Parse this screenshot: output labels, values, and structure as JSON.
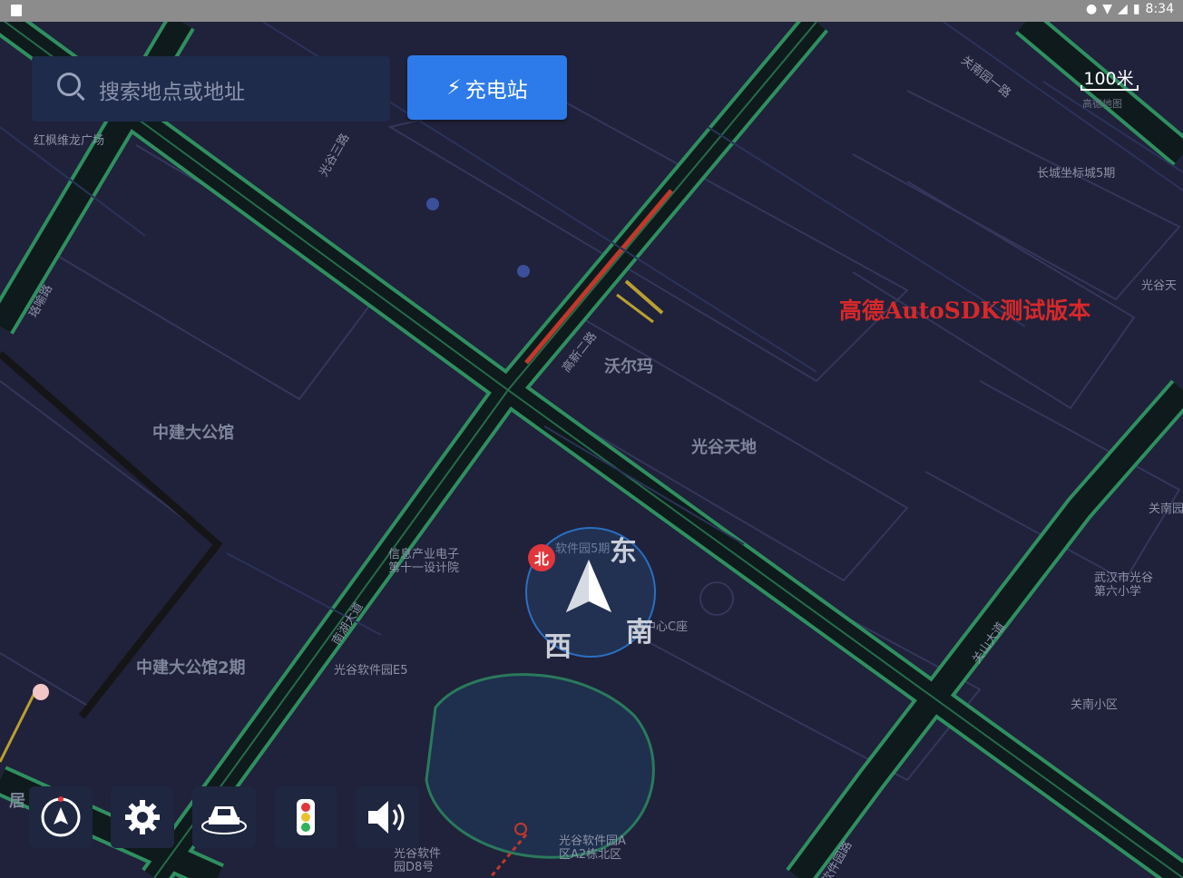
{
  "status_bar": {
    "time": "8:34"
  },
  "search": {
    "placeholder": "搜索地点或地址"
  },
  "charge_button": {
    "label": "充电站"
  },
  "scale": {
    "value": "100米",
    "source": "高德地图"
  },
  "watermark": "高德AutoSDK测试版本",
  "compass": {
    "north": "北",
    "east": "东",
    "west": "西",
    "south": "南"
  },
  "pois": {
    "hongfeng": "红枫维龙广场",
    "changcheng": "长城坐标城5期",
    "guanggutian": "光谷天",
    "woerma": "沃尔玛",
    "guanggutiandi": "光谷天地",
    "zhongjian": "中建大公馆",
    "zhongjian2": "中建大公馆2期",
    "xinxi": "信息产业电子\n第十一设计院",
    "ruanjian5": "软件园5期",
    "ruanjian_e5": "光谷软件园E5",
    "center_c": "D中心C座",
    "guannan_road": "关南园",
    "wuhanshi": "武汉市光谷\n第六小学",
    "guannan_xq": "关南小区",
    "ruanjian_a": "光谷软件园A\n区A2栋北区",
    "ruanjian_d8": "光谷软件\n园D8号",
    "ju": "居"
  },
  "roads": {
    "gaoxin2": "高新二路",
    "nanhu": "南湖大道",
    "guannan": "关南园一路",
    "ruanjian_road": "软件园路",
    "guanshan": "关山大道",
    "luyu": "珞喻路",
    "guangu_sandalu": "光谷三路"
  },
  "toolbar": {
    "items": [
      "compass-icon",
      "gear-icon",
      "car-view-icon",
      "traffic-light-icon",
      "volume-icon"
    ]
  },
  "colors": {
    "map_bg": "#20213a",
    "road_green": "#2f8f60",
    "road_dark": "#0f1a1c",
    "accent_blue": "#2d7bea",
    "watermark_red": "#d7282a",
    "traffic_red": "#c0392b",
    "traffic_yellow": "#b8a032"
  }
}
